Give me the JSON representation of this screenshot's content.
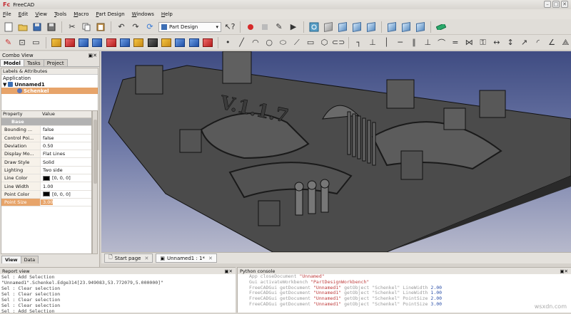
{
  "app": {
    "title": "FreeCAD",
    "logo": "Fc"
  },
  "window_buttons": [
    "–",
    "□",
    "✕"
  ],
  "menu": [
    "File",
    "Edit",
    "View",
    "Tools",
    "Macro",
    "Part Design",
    "Windows",
    "Help"
  ],
  "toolbar": {
    "workbench_label": "Part Design",
    "icons_row1": [
      "new-document-icon",
      "open-icon",
      "save-icon",
      "save-as-icon",
      "cut-icon",
      "copy-icon",
      "paste-icon",
      "undo-icon",
      "redo-icon",
      "refresh-icon",
      "whats-this-icon",
      "macro-record-icon",
      "macro-stop-icon",
      "macro-edit-icon",
      "macro-run-icon",
      "fit-all-icon",
      "isometric-icon",
      "front-view-icon",
      "top-view-icon",
      "right-view-icon",
      "rear-view-icon",
      "bottom-view-icon",
      "left-view-icon",
      "measure-icon"
    ]
  },
  "combo": {
    "title": "Combo View",
    "tabs": [
      "Model",
      "Tasks",
      "Project"
    ],
    "tree_header": "Labels & Attributes",
    "tree_section": "Application",
    "doc_name": "Unnamed1",
    "body_name": "Schenkel"
  },
  "props": {
    "col_property": "Property",
    "col_value": "Value",
    "group": "Base",
    "rows": [
      {
        "k": "Bounding ...",
        "v": "false"
      },
      {
        "k": "Control Poi...",
        "v": "false"
      },
      {
        "k": "Deviation",
        "v": "0.50"
      },
      {
        "k": "Display Mo...",
        "v": "Flat Lines"
      },
      {
        "k": "Draw Style",
        "v": "Solid"
      },
      {
        "k": "Lighting",
        "v": "Two side"
      },
      {
        "k": "Line Color",
        "v": "[0, 0, 0]",
        "swatch": true
      },
      {
        "k": "Line Width",
        "v": "1.00"
      },
      {
        "k": "Point Color",
        "v": "[0, 0, 0]",
        "swatch": true
      },
      {
        "k": "Point Size",
        "v": "3.00",
        "selected": true
      }
    ],
    "view_tabs": [
      "View",
      "Data"
    ]
  },
  "doc_tabs": [
    {
      "label": "Start page",
      "active": false
    },
    {
      "label": "Unnamed1 : 1*",
      "active": true
    }
  ],
  "model_text": "V.1.1.7",
  "report": {
    "title": "Report view",
    "lines": [
      "Sel : Add Selection",
      "\"Unnamed1\".Schenkel.Edge314[23.949083,53.772079,5.000000]\"",
      "Sel : Clear selection",
      "Sel : Clear selection",
      "Sel : Clear selection",
      "Sel : Clear selection",
      "Sel : Add Selection"
    ]
  },
  "python": {
    "title": "Python console",
    "lines": [
      {
        "pre": "App closeDocument ",
        "s": "\"Unnamed\"",
        "post": "",
        "num": ""
      },
      {
        "pre": "Gui activateWorkbench ",
        "s": "\"PartDesignWorkbench\"",
        "post": "",
        "num": ""
      },
      {
        "pre": "FreeCADGui getDocument ",
        "s": "\"Unnamed1\"",
        "post": " getObject \"Schenkel\" LineWidth",
        "num": "2.00"
      },
      {
        "pre": "FreeCADGui getDocument ",
        "s": "\"Unnamed1\"",
        "post": " getObject \"Schenkel\" LineWidth",
        "num": "1.00"
      },
      {
        "pre": "FreeCADGui getDocument ",
        "s": "\"Unnamed1\"",
        "post": " getObject \"Schenkel\" PointSize",
        "num": "2.00"
      },
      {
        "pre": "FreeCADGui getDocument ",
        "s": "\"Unnamed1\"",
        "post": " getObject \"Schenkel\" PointSize",
        "num": "3.00"
      }
    ]
  },
  "watermark": "wsxdn.com"
}
